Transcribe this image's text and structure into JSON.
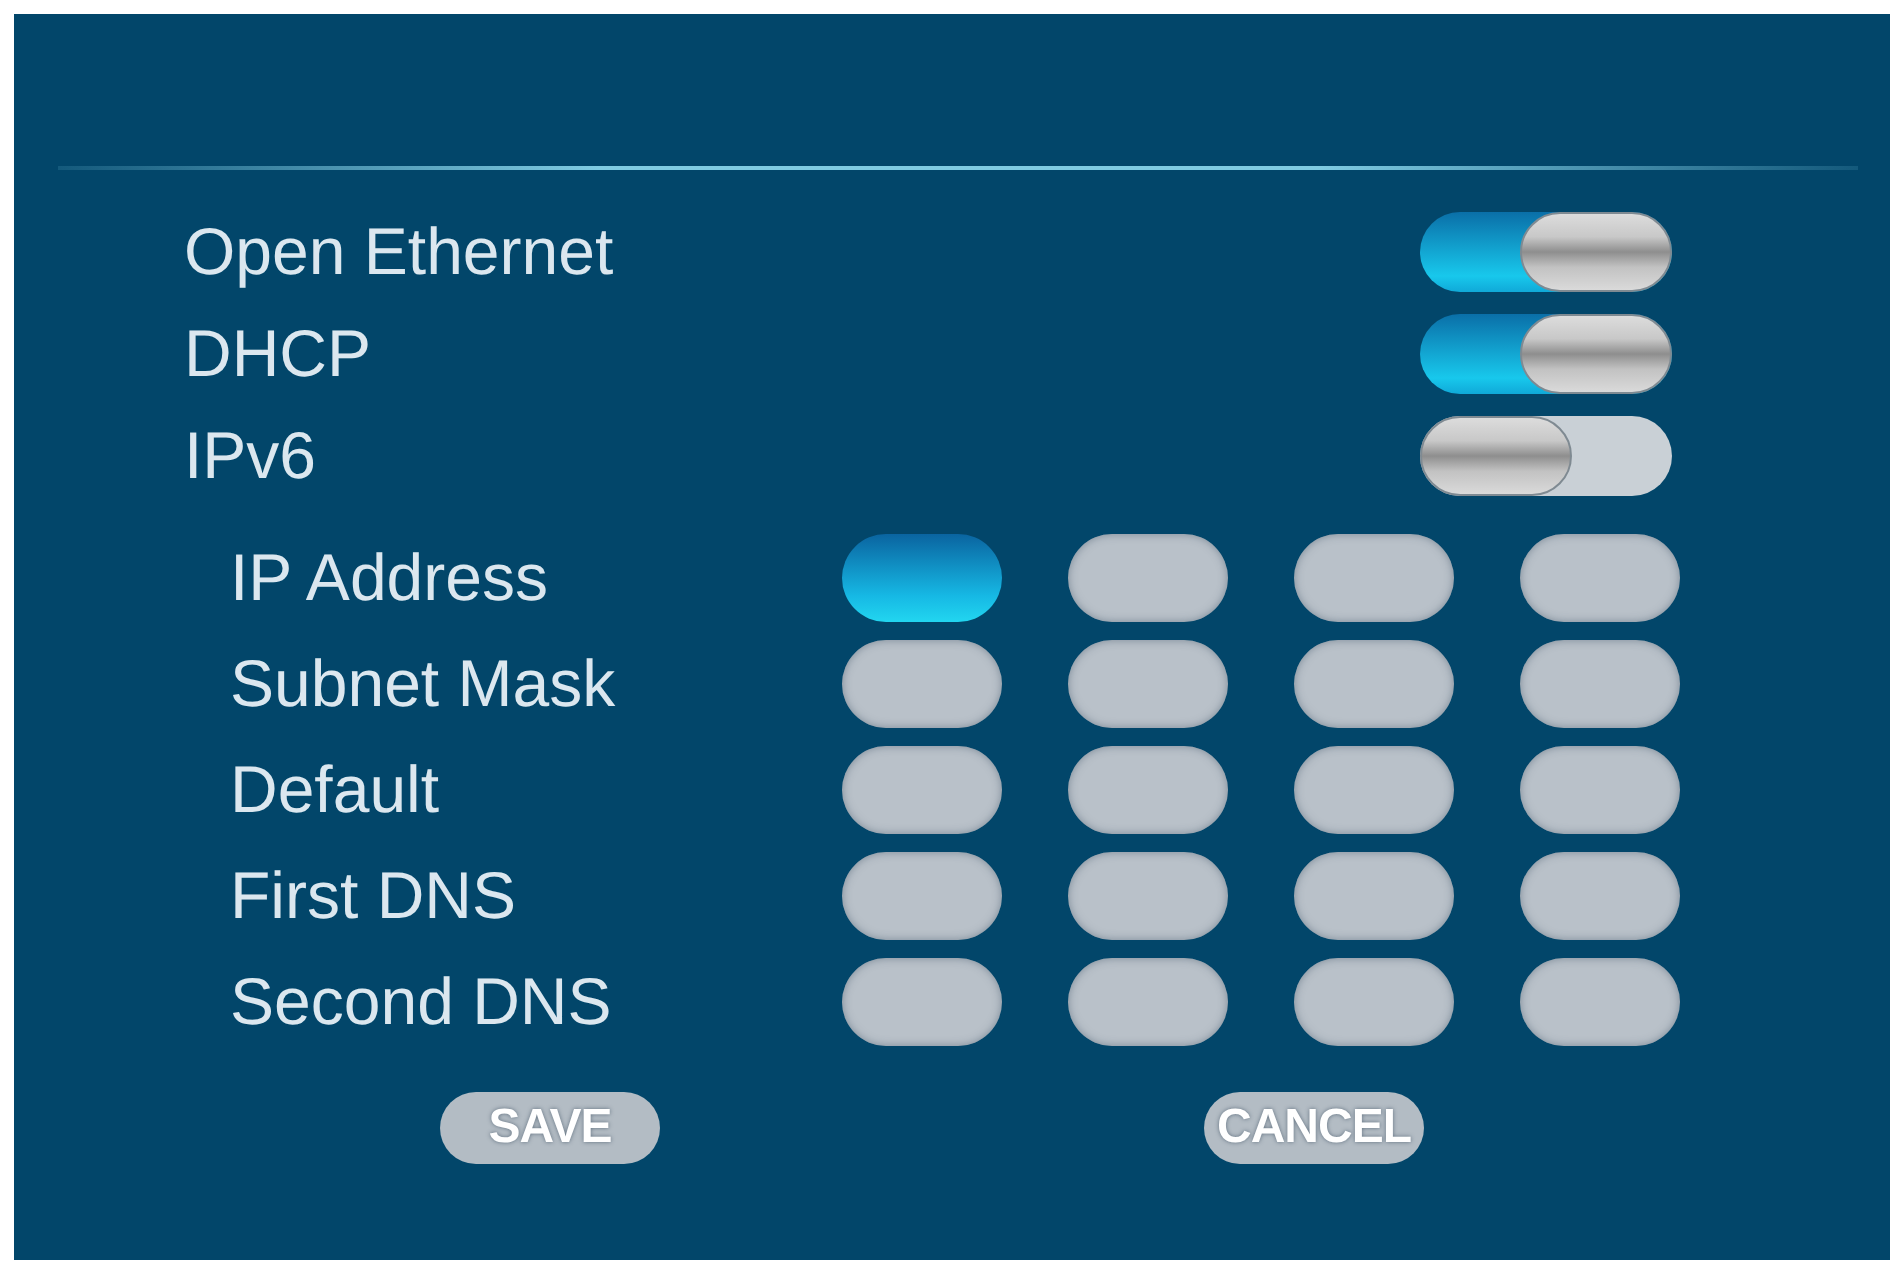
{
  "toggles": [
    {
      "label": "Open Ethernet",
      "on": true
    },
    {
      "label": "DHCP",
      "on": true
    },
    {
      "label": "IPv6",
      "on": false
    }
  ],
  "address_rows": [
    {
      "label": "IP Address",
      "fields": [
        {
          "focused": true
        },
        {
          "focused": false
        },
        {
          "focused": false
        },
        {
          "focused": false
        }
      ]
    },
    {
      "label": "Subnet Mask",
      "fields": [
        {
          "focused": false
        },
        {
          "focused": false
        },
        {
          "focused": false
        },
        {
          "focused": false
        }
      ]
    },
    {
      "label": "Default",
      "fields": [
        {
          "focused": false
        },
        {
          "focused": false
        },
        {
          "focused": false
        },
        {
          "focused": false
        }
      ]
    },
    {
      "label": "First DNS",
      "fields": [
        {
          "focused": false
        },
        {
          "focused": false
        },
        {
          "focused": false
        },
        {
          "focused": false
        }
      ]
    },
    {
      "label": "Second DNS",
      "fields": [
        {
          "focused": false
        },
        {
          "focused": false
        },
        {
          "focused": false
        },
        {
          "focused": false
        }
      ]
    }
  ],
  "buttons": [
    "SAVE",
    "CANCEL"
  ]
}
